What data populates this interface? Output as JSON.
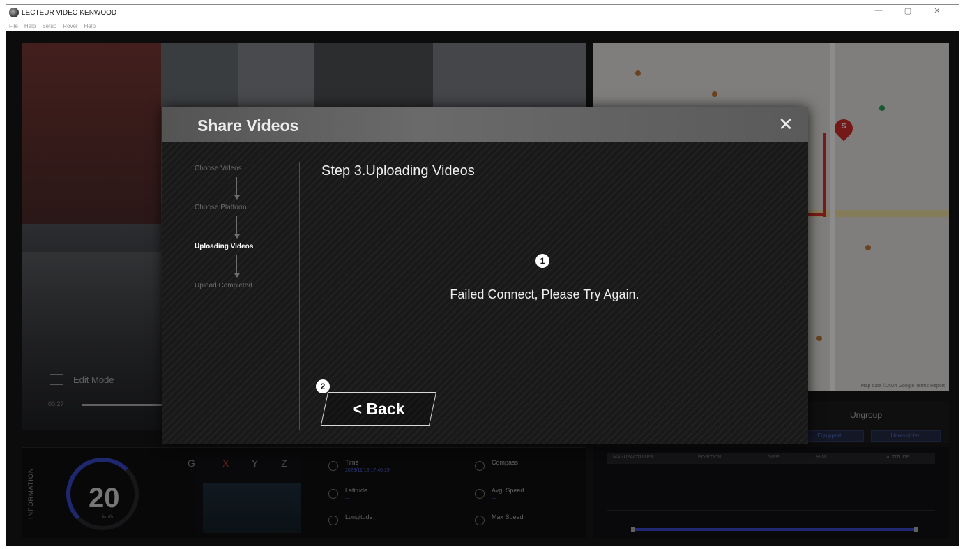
{
  "app": {
    "title": "LECTEUR VIDEO KENWOOD",
    "window_controls": {
      "minimize": "—",
      "maximize": "▢",
      "close": "✕"
    },
    "menu": [
      "File",
      "Help",
      "Setup",
      "Rover",
      "Help"
    ]
  },
  "video": {
    "edit_mode_label": "Edit Mode",
    "time": "00:27",
    "progress": 0.99
  },
  "map": {
    "pin_label": "S",
    "attribution": "Map data ©2024 Google  Terms  Report"
  },
  "toolbar": {
    "ungroup_label": "Ungroup",
    "tabs": [
      "Equipped",
      "Unrestricted"
    ]
  },
  "info": {
    "section_label": "INFORMATION",
    "speed": "20",
    "speed_unit": "km/h",
    "g_label": "G",
    "axes": [
      "X",
      "Y",
      "Z"
    ],
    "stats": [
      {
        "label": "Time",
        "value": "2023/11/18 17:40:19"
      },
      {
        "label": "Latitude",
        "value": "—"
      },
      {
        "label": "Longitude",
        "value": "—"
      },
      {
        "label": "Compass",
        "value": ""
      },
      {
        "label": "Avg. Speed",
        "value": "—"
      },
      {
        "label": "Max Speed",
        "value": "—"
      }
    ]
  },
  "table": {
    "columns": [
      "MANUFACTURER",
      "POSITION",
      "DIRE",
      "H-M",
      "ALTITUDE"
    ]
  },
  "modal": {
    "title": "Share Videos",
    "close_icon": "close-icon",
    "steps": [
      {
        "label": "Choose Videos",
        "active": false
      },
      {
        "label": "Choose Platform",
        "active": false
      },
      {
        "label": "Uploading Videos",
        "active": true
      },
      {
        "label": "Upload Completed",
        "active": false
      }
    ],
    "step_heading": "Step 3.Uploading Videos",
    "message": "Failed Connect, Please Try Again.",
    "callout_1": "1",
    "callout_2": "2",
    "back_label": "< Back"
  }
}
